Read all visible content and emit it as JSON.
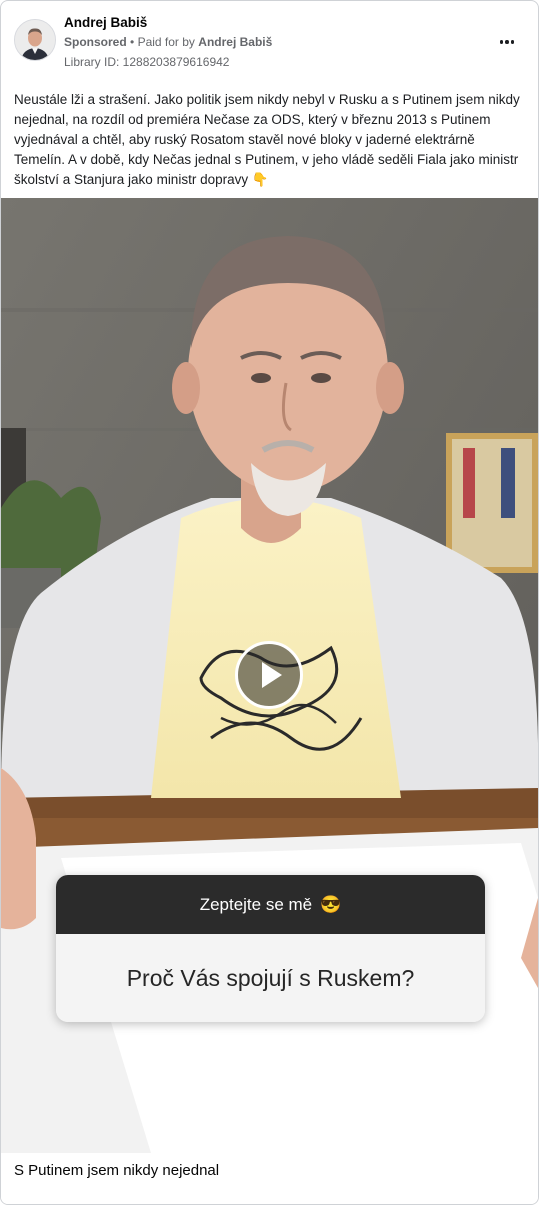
{
  "ad": {
    "page_name": "Andrej Babiš",
    "sponsored_label": "Sponsored",
    "separator": "•",
    "paid_for_prefix": "Paid for by",
    "paid_for_name": "Andrej Babiš",
    "library_id": "Library ID: 1288203879616942",
    "body_text": "Neustále lži a strašení. Jako politik jsem nikdy nebyl v Rusku a s Putinem jsem nikdy nejednal, na rozdíl od premiéra Nečase za ODS, který v březnu 2013 s Putinem vyjednával a chtěl, aby ruský Rosatom stavěl nové bloky v jaderné elektrárně Temelín. A v době, kdy Nečas jednal s Putinem, v jeho vládě seděli Fiala jako ministr školství a Stanjura jako ministr dopravy 👇",
    "options_icon": "more-horizontal-icon"
  },
  "video": {
    "play_icon": "play-icon",
    "question_header": "Zeptejte se mě",
    "question_emoji": "😎",
    "question_text": "Proč Vás spojují s Ruskem?"
  },
  "footer": {
    "caption": "S Putinem jsem nikdy nejednal"
  },
  "colors": {
    "name_text": "#050505",
    "meta_text": "#65676b",
    "border": "#cfd2d6",
    "question_header_bg": "#2b2b2b",
    "question_body_bg": "#f4f4f4"
  }
}
